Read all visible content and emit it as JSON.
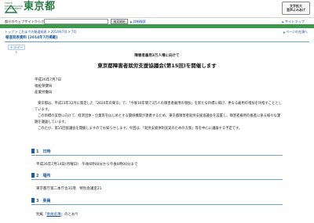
{
  "header": {
    "logo_small": "TOKYO METROPOLITAN GOVERNMENT",
    "logo_text": "東京都",
    "a11y_line1": "文字拡大",
    "a11y_line2": "音声よみあげ"
  },
  "search": {
    "label": "都庁のウェブサイトからさがす",
    "button": "検索開始",
    "detail_link": "詳細検索",
    "sitemap_link": "サイトマップ"
  },
  "breadcrumb": {
    "items": [
      "トップ",
      "これまでの報道発表",
      "2014年7月",
      "7月"
    ],
    "to_top": "ページの先頭へ"
  },
  "release": {
    "bar_label": "報道発表資料 [2014年7月掲載]",
    "tweet": "ツイート",
    "subtitle": "障害者雇用3万人増に向けて",
    "title": "東京都障害者就労支援協議会(第15回)を開催します",
    "date": "平成26年7月7日",
    "dept1": "福祉保健局",
    "dept2": "産業労働局"
  },
  "body": {
    "p1": "東京都は、平成23年12月に策定した「2020年の東京」で、「今後10年間で3万人の障害者雇用の増加」を新たな目標に掲げ、更なる雇用の増加を目指すこととしています。",
    "p2": "この目標の実現に向けて、経済団体・企業等をはじめとする関係機関が連携するため、東京都障害者就労支援協議会を設置し、障害者雇用の推進に係る様々な課題を議論しています。",
    "p3": "このたび、第15回協議会を開催しますのでお知らせします。今回は、「就労支援体制充実のための方策」等を中心に議論する予定です。"
  },
  "sections": {
    "s1_title": "1　日時",
    "s1_text": "平成26年7月14日(月曜日)　午後6時00分から午後8時00分まで",
    "s2_title": "2　場所",
    "s2_text": "東京都庁第二本庁舎31階　特別会議室21",
    "s3_title": "3　委員",
    "s3_prefix": "別紙「",
    "s3_link": "委員名簿",
    "s3_suffix": "」のとおり"
  }
}
